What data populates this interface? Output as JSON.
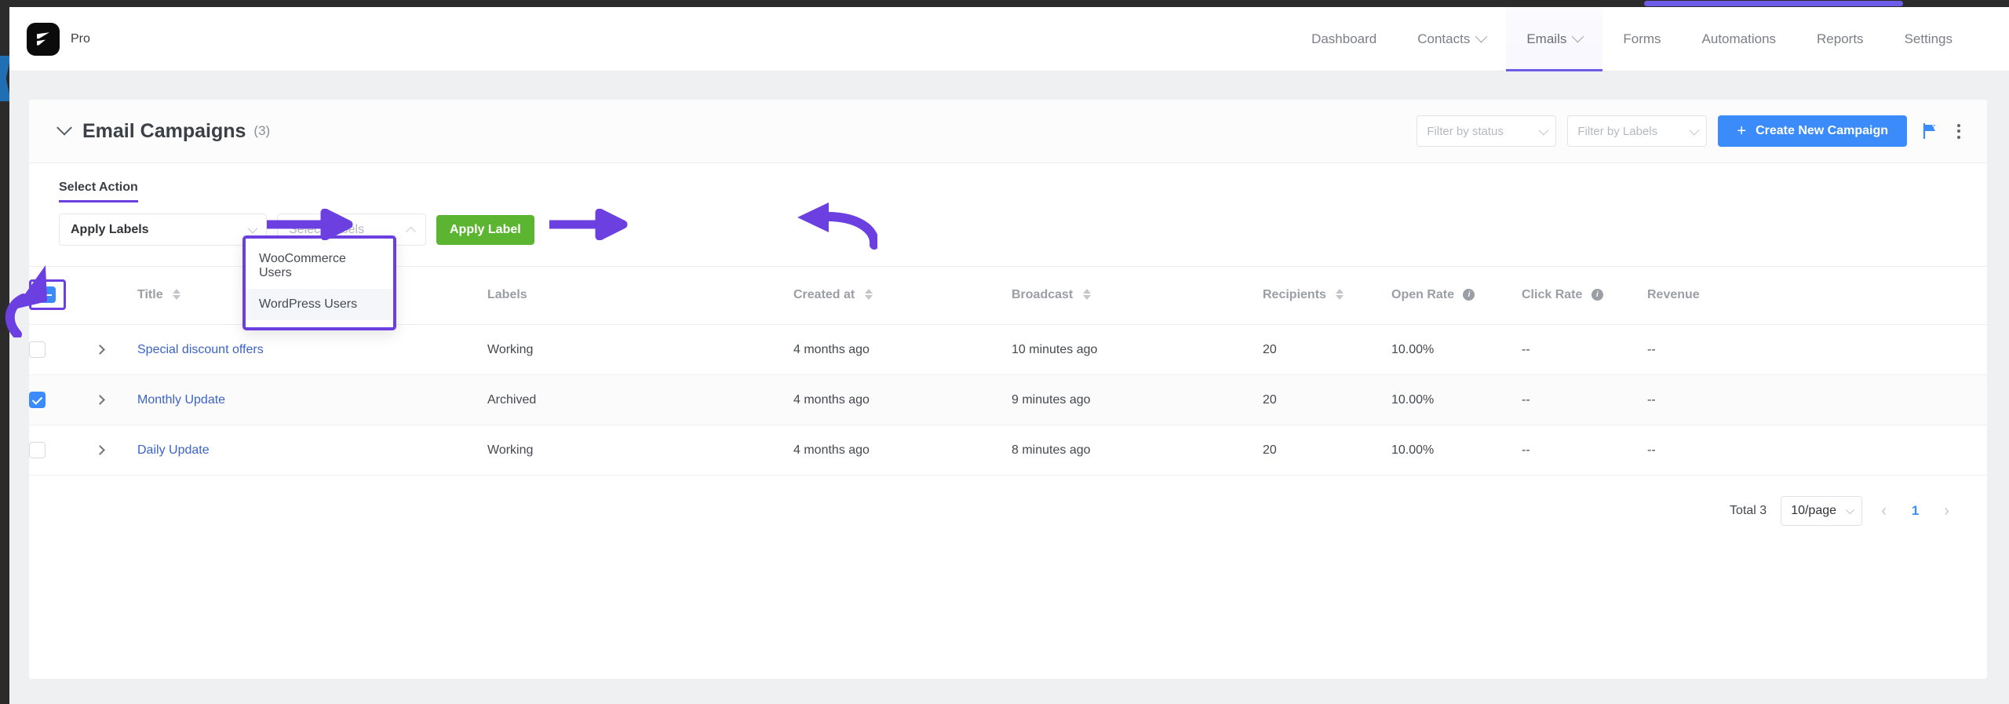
{
  "brand": {
    "logo_icon": "fluent-logo-icon",
    "edition": "Pro"
  },
  "nav": {
    "items": [
      {
        "label": "Dashboard",
        "has_caret": false,
        "active": false
      },
      {
        "label": "Contacts",
        "has_caret": true,
        "active": false
      },
      {
        "label": "Emails",
        "has_caret": true,
        "active": true
      },
      {
        "label": "Forms",
        "has_caret": false,
        "active": false
      },
      {
        "label": "Automations",
        "has_caret": false,
        "active": false
      },
      {
        "label": "Reports",
        "has_caret": false,
        "active": false
      },
      {
        "label": "Settings",
        "has_caret": false,
        "active": false
      }
    ]
  },
  "card": {
    "title": "Email Campaigns",
    "count": "(3)",
    "filter_status_placeholder": "Filter by status",
    "filter_labels_placeholder": "Filter by Labels",
    "create_button": "Create New Campaign",
    "create_button_plus": "+",
    "flag_icon": "flag-icon",
    "kebab_icon": "more-options-icon"
  },
  "action_bar": {
    "label": "Select Action",
    "action_value": "Apply Labels",
    "labels_placeholder": "Select Labels",
    "apply_button": "Apply Label",
    "labels_menu": {
      "options": [
        {
          "label": "WooCommerce Users",
          "hover": false
        },
        {
          "label": "WordPress Users",
          "hover": true
        }
      ]
    }
  },
  "table": {
    "select_all_state": "indeterminate",
    "columns": [
      {
        "key": "title",
        "label": "Title",
        "sortable": true
      },
      {
        "key": "labels",
        "label": "Labels",
        "sortable": false
      },
      {
        "key": "created_at",
        "label": "Created at",
        "sortable": true
      },
      {
        "key": "broadcast",
        "label": "Broadcast",
        "sortable": true
      },
      {
        "key": "recipients",
        "label": "Recipients",
        "sortable": true
      },
      {
        "key": "open_rate",
        "label": "Open Rate",
        "sortable": false,
        "info": true
      },
      {
        "key": "click_rate",
        "label": "Click Rate",
        "sortable": false,
        "info": true
      },
      {
        "key": "revenue",
        "label": "Revenue",
        "sortable": false
      }
    ],
    "rows": [
      {
        "selected": false,
        "title": "Special discount offers",
        "labels": "Working",
        "created_at": "4 months ago",
        "broadcast": "10 minutes ago",
        "recipients": "20",
        "open_rate": "10.00%",
        "click_rate": "--",
        "revenue": "--"
      },
      {
        "selected": true,
        "title": "Monthly Update",
        "labels": "Archived",
        "created_at": "4 months ago",
        "broadcast": "9 minutes ago",
        "recipients": "20",
        "open_rate": "10.00%",
        "click_rate": "--",
        "revenue": "--"
      },
      {
        "selected": false,
        "title": "Daily Update",
        "labels": "Working",
        "created_at": "4 months ago",
        "broadcast": "8 minutes ago",
        "recipients": "20",
        "open_rate": "10.00%",
        "click_rate": "--",
        "revenue": "--"
      }
    ]
  },
  "footer": {
    "total": "Total 3",
    "page_size": "10/page",
    "prev_icon": "chevron-left-icon",
    "next_icon": "chevron-right-icon",
    "current_page": "1"
  },
  "colors": {
    "accent_purple": "#6c3fe0",
    "primary_blue": "#3b8bfa",
    "apply_green": "#5cb530",
    "link_blue": "#3c63c8",
    "page_bg": "#eef0f2"
  }
}
